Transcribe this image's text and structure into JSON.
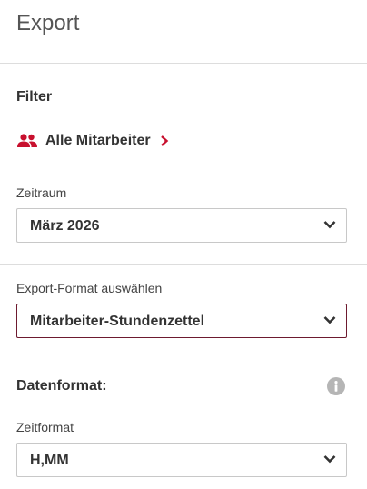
{
  "header": {
    "title": "Export"
  },
  "filter": {
    "title": "Filter",
    "employees_link": "Alle Mitarbeiter"
  },
  "period": {
    "label": "Zeitraum",
    "value": "März 2026"
  },
  "export_format": {
    "label": "Export-Format auswählen",
    "value": "Mitarbeiter-Stundenzettel"
  },
  "data_format": {
    "title": "Datenformat:",
    "info_icon": "info-icon"
  },
  "time_format": {
    "label": "Zeitformat",
    "value": "H,MM"
  },
  "colors": {
    "accent": "#c8102e",
    "active_border": "#6d1a2f",
    "info_icon": "#b5b5b5"
  }
}
